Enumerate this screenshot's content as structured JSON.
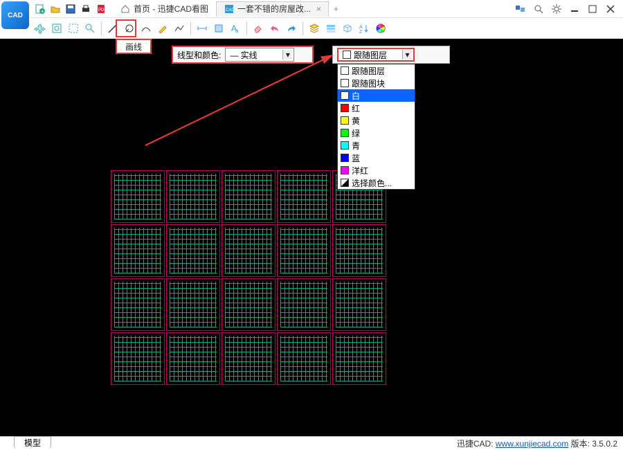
{
  "app": {
    "logo_text": "CAD"
  },
  "tabs": {
    "home_label": "首页 - 迅捷CAD看图",
    "file_label": "一套不错的房屋改...",
    "close_glyph": "×",
    "add_glyph": "+"
  },
  "callouts": {
    "line_label": "画线",
    "style_label": "线型和颜色:"
  },
  "combos": {
    "linetype_value": "— 实线",
    "color_value": "跟随图层",
    "arrow": "▾"
  },
  "dropdown": {
    "items": [
      {
        "label": "跟随图层",
        "swatch": "#ffffff",
        "border": "#333"
      },
      {
        "label": "跟随图块",
        "swatch": "#ffffff",
        "border": "#333"
      },
      {
        "label": "白",
        "swatch": "#ffffff",
        "border": "#333",
        "hover": true
      },
      {
        "label": "红",
        "swatch": "#ff0000",
        "border": "#333"
      },
      {
        "label": "黄",
        "swatch": "#ffff00",
        "border": "#333"
      },
      {
        "label": "绿",
        "swatch": "#00ff00",
        "border": "#333"
      },
      {
        "label": "青",
        "swatch": "#00ffff",
        "border": "#333"
      },
      {
        "label": "蓝",
        "swatch": "#0000ff",
        "border": "#333"
      },
      {
        "label": "洋红",
        "swatch": "#ff00ff",
        "border": "#333"
      },
      {
        "label": "选择颜色...",
        "swatch": "linear-gradient(135deg,#fff 49%,#000 51%)",
        "border": "#333"
      }
    ]
  },
  "status": {
    "model_tab": "模型",
    "brand": "迅捷CAD:",
    "url": "www.xunjiecad.com",
    "version_label": "版本:",
    "version": "3.5.0.2"
  }
}
